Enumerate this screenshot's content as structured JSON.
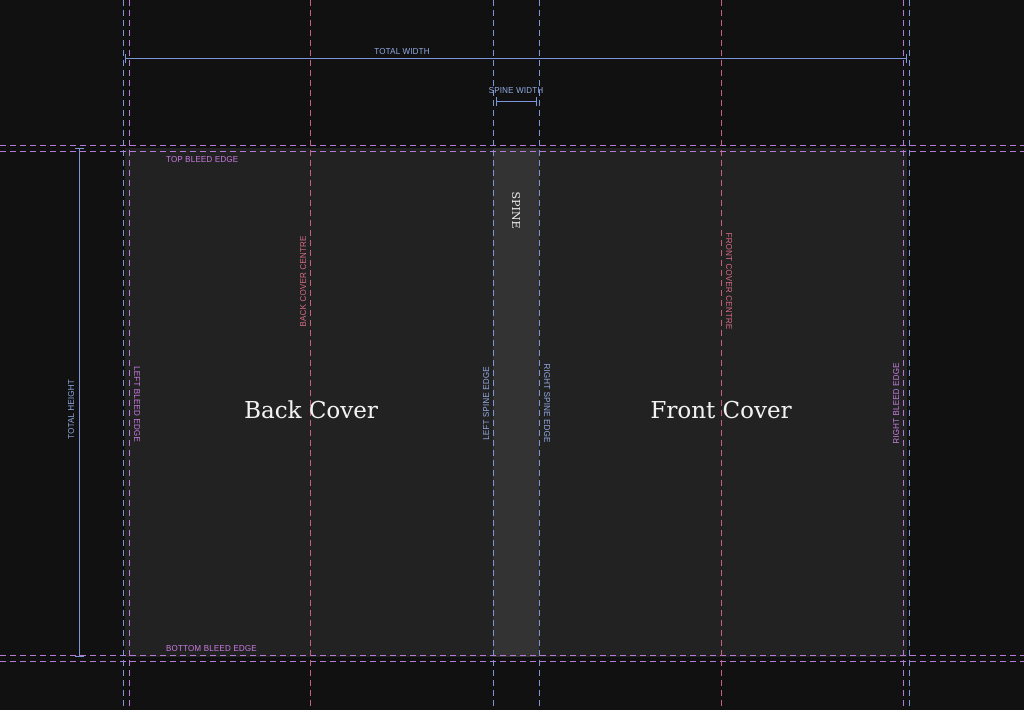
{
  "colors": {
    "background": "#111111",
    "cover_fill": "#222222",
    "spine_fill": "#333333",
    "bleed_guide": "#b57ad6",
    "spine_guide": "#7f95d9",
    "centre_guide": "#c95f7f",
    "bleed_label": "#c77be0",
    "spine_label": "#90a8e0",
    "centre_label": "#d46b86",
    "dimension": "#7f95d9"
  },
  "dimensions": {
    "total_width_label": "TOTAL WIDTH",
    "spine_width_label": "SPINE WIDTH",
    "total_height_label": "TOTAL HEIGHT"
  },
  "guides": {
    "top_bleed_edge": "TOP BLEED EDGE",
    "bottom_bleed_edge": "BOTTOM BLEED EDGE",
    "left_bleed_edge": "LEFT BLEED EDGE",
    "right_bleed_edge": "RIGHT BLEED EDGE",
    "left_spine_edge": "LEFT SPINE EDGE",
    "right_spine_edge": "RIGHT SPINE EDGE",
    "back_cover_centre": "BACK COVER CENTRE",
    "front_cover_centre": "FRONT COVER CENTRE"
  },
  "panels": {
    "back_cover": "Back Cover",
    "front_cover": "Front Cover",
    "spine": "SPINE"
  }
}
